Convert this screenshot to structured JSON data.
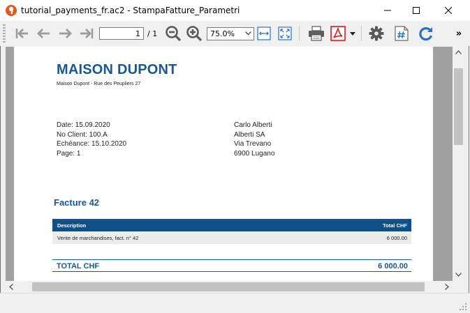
{
  "window": {
    "title": "tutorial_payments_fr.ac2 - StampaFatture_Parametri"
  },
  "toolbar": {
    "page_current": "1",
    "page_total": "/ 1",
    "zoom": "75.0%",
    "overflow": "»"
  },
  "document": {
    "company_name": "MAISON DUPONT",
    "company_address": "Maison Dupont - Rue des Peupliers 27",
    "info_lines": [
      "Date: 15.09.2020",
      "No Client: 100.A",
      "Echéance: 15.10.2020",
      "Page: 1"
    ],
    "recipient_lines": [
      "Carlo Alberti",
      "Alberti SA",
      "Via Trevano",
      "6900 Lugano"
    ],
    "invoice_title": "Facture 42",
    "table": {
      "headers": [
        "Description",
        "Total CHF"
      ],
      "rows": [
        {
          "description": "Vente de marchandises, fact. n° 42",
          "amount": "6 000.00"
        }
      ]
    },
    "total_label": "TOTAL CHF",
    "total_amount": "6 000.00"
  },
  "colors": {
    "brand_blue": "#1a5690",
    "table_header": "#114f8a",
    "pdf_red": "#d21d1d",
    "icon_blue": "#2a6fc9"
  }
}
